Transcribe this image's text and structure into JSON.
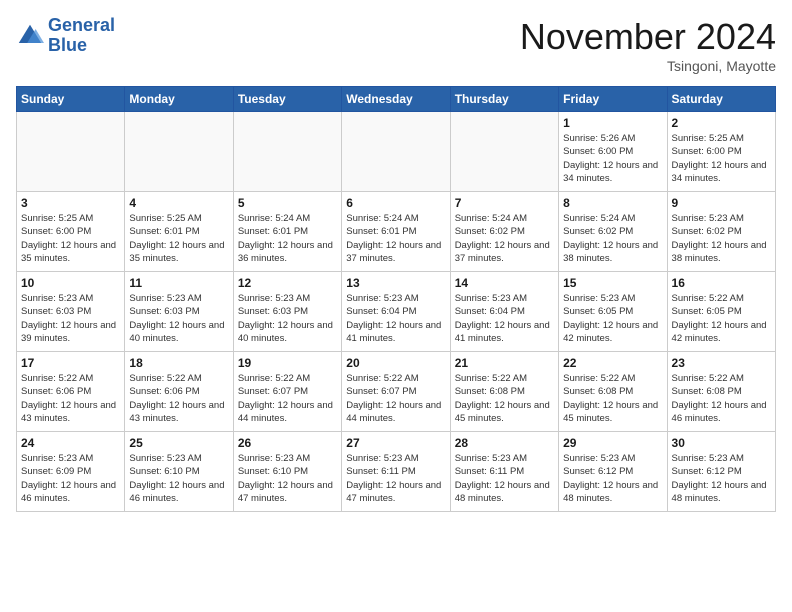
{
  "header": {
    "logo_line1": "General",
    "logo_line2": "Blue",
    "month": "November 2024",
    "location": "Tsingoni, Mayotte"
  },
  "weekdays": [
    "Sunday",
    "Monday",
    "Tuesday",
    "Wednesday",
    "Thursday",
    "Friday",
    "Saturday"
  ],
  "weeks": [
    [
      {
        "day": "",
        "info": ""
      },
      {
        "day": "",
        "info": ""
      },
      {
        "day": "",
        "info": ""
      },
      {
        "day": "",
        "info": ""
      },
      {
        "day": "",
        "info": ""
      },
      {
        "day": "1",
        "info": "Sunrise: 5:26 AM\nSunset: 6:00 PM\nDaylight: 12 hours and 34 minutes."
      },
      {
        "day": "2",
        "info": "Sunrise: 5:25 AM\nSunset: 6:00 PM\nDaylight: 12 hours and 34 minutes."
      }
    ],
    [
      {
        "day": "3",
        "info": "Sunrise: 5:25 AM\nSunset: 6:00 PM\nDaylight: 12 hours and 35 minutes."
      },
      {
        "day": "4",
        "info": "Sunrise: 5:25 AM\nSunset: 6:01 PM\nDaylight: 12 hours and 35 minutes."
      },
      {
        "day": "5",
        "info": "Sunrise: 5:24 AM\nSunset: 6:01 PM\nDaylight: 12 hours and 36 minutes."
      },
      {
        "day": "6",
        "info": "Sunrise: 5:24 AM\nSunset: 6:01 PM\nDaylight: 12 hours and 37 minutes."
      },
      {
        "day": "7",
        "info": "Sunrise: 5:24 AM\nSunset: 6:02 PM\nDaylight: 12 hours and 37 minutes."
      },
      {
        "day": "8",
        "info": "Sunrise: 5:24 AM\nSunset: 6:02 PM\nDaylight: 12 hours and 38 minutes."
      },
      {
        "day": "9",
        "info": "Sunrise: 5:23 AM\nSunset: 6:02 PM\nDaylight: 12 hours and 38 minutes."
      }
    ],
    [
      {
        "day": "10",
        "info": "Sunrise: 5:23 AM\nSunset: 6:03 PM\nDaylight: 12 hours and 39 minutes."
      },
      {
        "day": "11",
        "info": "Sunrise: 5:23 AM\nSunset: 6:03 PM\nDaylight: 12 hours and 40 minutes."
      },
      {
        "day": "12",
        "info": "Sunrise: 5:23 AM\nSunset: 6:03 PM\nDaylight: 12 hours and 40 minutes."
      },
      {
        "day": "13",
        "info": "Sunrise: 5:23 AM\nSunset: 6:04 PM\nDaylight: 12 hours and 41 minutes."
      },
      {
        "day": "14",
        "info": "Sunrise: 5:23 AM\nSunset: 6:04 PM\nDaylight: 12 hours and 41 minutes."
      },
      {
        "day": "15",
        "info": "Sunrise: 5:23 AM\nSunset: 6:05 PM\nDaylight: 12 hours and 42 minutes."
      },
      {
        "day": "16",
        "info": "Sunrise: 5:22 AM\nSunset: 6:05 PM\nDaylight: 12 hours and 42 minutes."
      }
    ],
    [
      {
        "day": "17",
        "info": "Sunrise: 5:22 AM\nSunset: 6:06 PM\nDaylight: 12 hours and 43 minutes."
      },
      {
        "day": "18",
        "info": "Sunrise: 5:22 AM\nSunset: 6:06 PM\nDaylight: 12 hours and 43 minutes."
      },
      {
        "day": "19",
        "info": "Sunrise: 5:22 AM\nSunset: 6:07 PM\nDaylight: 12 hours and 44 minutes."
      },
      {
        "day": "20",
        "info": "Sunrise: 5:22 AM\nSunset: 6:07 PM\nDaylight: 12 hours and 44 minutes."
      },
      {
        "day": "21",
        "info": "Sunrise: 5:22 AM\nSunset: 6:08 PM\nDaylight: 12 hours and 45 minutes."
      },
      {
        "day": "22",
        "info": "Sunrise: 5:22 AM\nSunset: 6:08 PM\nDaylight: 12 hours and 45 minutes."
      },
      {
        "day": "23",
        "info": "Sunrise: 5:22 AM\nSunset: 6:08 PM\nDaylight: 12 hours and 46 minutes."
      }
    ],
    [
      {
        "day": "24",
        "info": "Sunrise: 5:23 AM\nSunset: 6:09 PM\nDaylight: 12 hours and 46 minutes."
      },
      {
        "day": "25",
        "info": "Sunrise: 5:23 AM\nSunset: 6:10 PM\nDaylight: 12 hours and 46 minutes."
      },
      {
        "day": "26",
        "info": "Sunrise: 5:23 AM\nSunset: 6:10 PM\nDaylight: 12 hours and 47 minutes."
      },
      {
        "day": "27",
        "info": "Sunrise: 5:23 AM\nSunset: 6:11 PM\nDaylight: 12 hours and 47 minutes."
      },
      {
        "day": "28",
        "info": "Sunrise: 5:23 AM\nSunset: 6:11 PM\nDaylight: 12 hours and 48 minutes."
      },
      {
        "day": "29",
        "info": "Sunrise: 5:23 AM\nSunset: 6:12 PM\nDaylight: 12 hours and 48 minutes."
      },
      {
        "day": "30",
        "info": "Sunrise: 5:23 AM\nSunset: 6:12 PM\nDaylight: 12 hours and 48 minutes."
      }
    ]
  ]
}
